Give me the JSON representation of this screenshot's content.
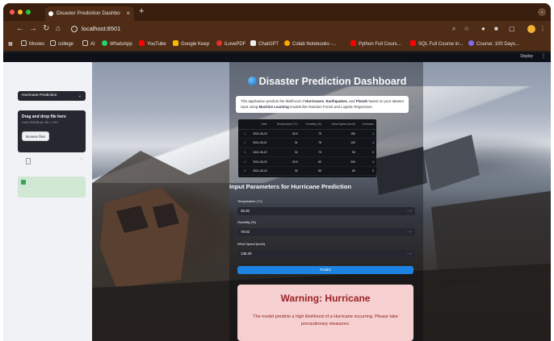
{
  "browser": {
    "tab_title": "Disaster Prediction Dashbo",
    "url": "localhost:8501",
    "bookmarks": [
      "Movies",
      "college",
      "AI",
      "WhatsApp",
      "YouTube",
      "Google Keep",
      "iLovePDF",
      "ChatGPT",
      "Colab Notebooks -...",
      "Python Full Cours...",
      "SQL Full Course in...",
      "Course: 100 Days..."
    ]
  },
  "app": {
    "deploy_label": "Deploy",
    "menu_glyph": "⋮"
  },
  "sidebar": {
    "selected_option": "Hurricane Prediction",
    "uploader_title": "Drag and drop file here",
    "uploader_limit": "Limit 200MB per file • CSV",
    "browse_label": "Browse files"
  },
  "main": {
    "title": "Disaster Prediction Dashboard",
    "description_parts": [
      "This application predicts the likelihood of ",
      "Hurricanes",
      ", ",
      "Earthquakes",
      ", and ",
      "Floods",
      " based on your dataset input using ",
      "Machine Learning",
      " models like Random Forest and Logistic Regression."
    ],
    "table": {
      "headers": [
        "",
        "Date",
        "Temperature (°C)",
        "Humidity (%)",
        "Wind Speed (km/h)",
        "Hurricane"
      ],
      "rows": [
        [
          "1",
          "2021-06-20",
          "30.5",
          "75",
          "150",
          "1"
        ],
        [
          "2",
          "2021-06-21",
          "31",
          "78",
          "130",
          "1"
        ],
        [
          "3",
          "2021-06-22",
          "32",
          "79",
          "90",
          "0"
        ],
        [
          "4",
          "2021-06-23",
          "33.5",
          "60",
          "200",
          "1"
        ],
        [
          "5",
          "2021-06-24",
          "30",
          "85",
          "80",
          "0"
        ]
      ]
    },
    "section_title": "Input Parameters for Hurricane Prediction",
    "inputs": [
      {
        "label": "Temperature (°C)",
        "value": "30.20"
      },
      {
        "label": "Humidity (%)",
        "value": "78.02"
      },
      {
        "label": "Wind Speed (km/h)",
        "value": "135.20"
      }
    ],
    "predict_label": "Predict",
    "warning": {
      "title": "Warning: Hurricane",
      "text": "The model predicts a high likelihood of a Hurricane occurring. Please take precautionary measures."
    }
  },
  "colors": {
    "accent": "#1c83e1",
    "warning_bg": "#f6d0d0",
    "warning_text": "#9b2226",
    "success_bg": "#cfe7d3"
  }
}
